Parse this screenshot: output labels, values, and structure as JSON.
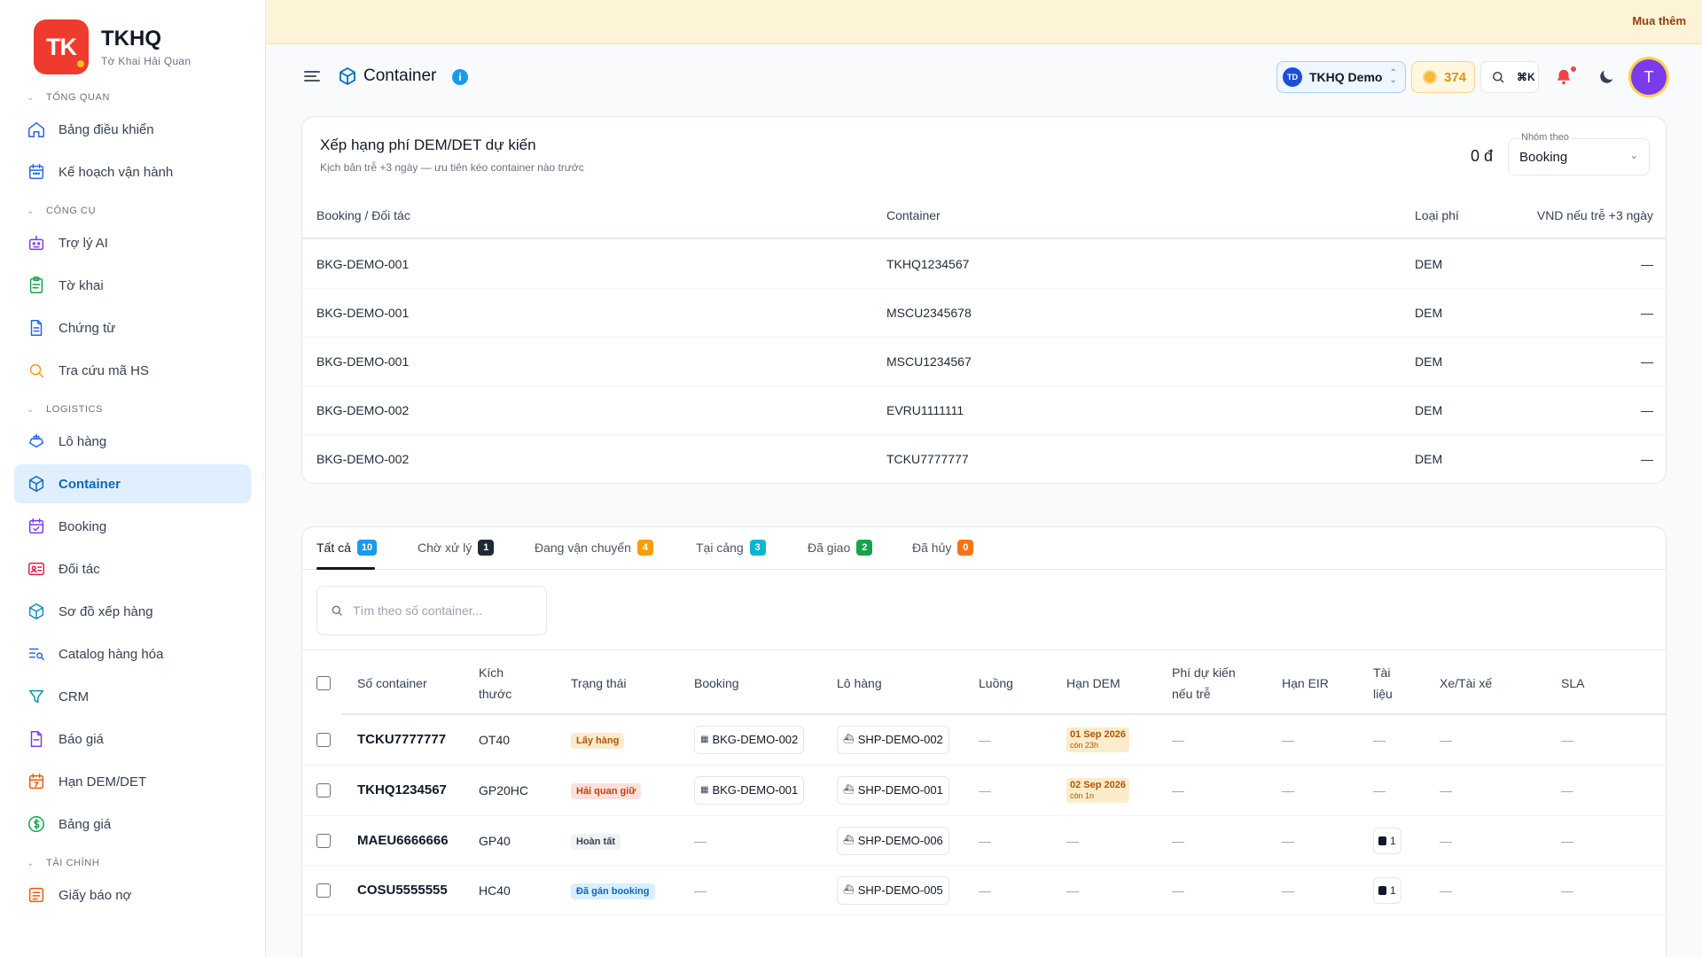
{
  "brand": {
    "logo": "TK",
    "title": "TKHQ",
    "subtitle": "Tờ Khai Hải Quan"
  },
  "sidebar": {
    "sections": [
      {
        "title": "TỔNG QUAN",
        "items": [
          {
            "label": "Bảng điều khiển",
            "icon": "home-icon"
          },
          {
            "label": "Kế hoạch vận hành",
            "icon": "calendar-icon"
          }
        ]
      },
      {
        "title": "CÔNG CỤ",
        "items": [
          {
            "label": "Trợ lý AI",
            "icon": "robot-icon"
          },
          {
            "label": "Tờ khai",
            "icon": "clipboard-icon"
          },
          {
            "label": "Chứng từ",
            "icon": "document-icon"
          },
          {
            "label": "Tra cứu mã HS",
            "icon": "search-icon"
          }
        ]
      },
      {
        "title": "LOGISTICS",
        "items": [
          {
            "label": "Lô hàng",
            "icon": "ship-icon"
          },
          {
            "label": "Container",
            "icon": "box-icon",
            "active": true
          },
          {
            "label": "Booking",
            "icon": "calendar-check-icon"
          },
          {
            "label": "Đối tác",
            "icon": "id-card-icon"
          },
          {
            "label": "Sơ đồ xếp hàng",
            "icon": "cube-icon"
          },
          {
            "label": "Catalog hàng hóa",
            "icon": "list-search-icon"
          },
          {
            "label": "CRM",
            "icon": "funnel-icon"
          },
          {
            "label": "Báo giá",
            "icon": "quote-icon"
          },
          {
            "label": "Hạn DEM/DET",
            "icon": "calendar-deadline-icon"
          },
          {
            "label": "Bảng giá",
            "icon": "dollar-icon"
          }
        ]
      },
      {
        "title": "TÀI CHÍNH",
        "items": [
          {
            "label": "Giấy báo nợ",
            "icon": "receipt-icon"
          }
        ]
      }
    ]
  },
  "banner": {
    "buy_label": "Mua thêm"
  },
  "header": {
    "title": "Container",
    "workspace_initials": "TD",
    "workspace_name": "TKHQ Demo",
    "coins": "374",
    "search_shortcut": "⌘K",
    "user_initial": "T"
  },
  "ranking": {
    "title": "Xếp hạng phí DEM/DET dự kiến",
    "subtitle": "Kịch bản trễ +3 ngày — ưu tiên kéo container nào trước",
    "total": "0 đ",
    "group_label": "Nhóm theo",
    "group_value": "Booking",
    "columns": [
      "Booking / Đối tác",
      "Container",
      "Loại phí",
      "VND nếu trễ +3 ngày"
    ],
    "rows": [
      {
        "booking": "BKG-DEMO-001",
        "container": "TKHQ1234567",
        "fee": "DEM",
        "vnd": "—"
      },
      {
        "booking": "BKG-DEMO-001",
        "container": "MSCU2345678",
        "fee": "DEM",
        "vnd": "—"
      },
      {
        "booking": "BKG-DEMO-001",
        "container": "MSCU1234567",
        "fee": "DEM",
        "vnd": "—"
      },
      {
        "booking": "BKG-DEMO-002",
        "container": "EVRU1111111",
        "fee": "DEM",
        "vnd": "—"
      },
      {
        "booking": "BKG-DEMO-002",
        "container": "TCKU7777777",
        "fee": "DEM",
        "vnd": "—"
      }
    ]
  },
  "tabs": [
    {
      "label": "Tất cả",
      "count": "10",
      "color": "#1a9bea"
    },
    {
      "label": "Chờ xử lý",
      "count": "1",
      "color": "#1f2937"
    },
    {
      "label": "Đang vận chuyển",
      "count": "4",
      "color": "#f59e0b"
    },
    {
      "label": "Tại cảng",
      "count": "3",
      "color": "#06b6d4"
    },
    {
      "label": "Đã giao",
      "count": "2",
      "color": "#16a34a"
    },
    {
      "label": "Đã hủy",
      "count": "0",
      "color": "#f97316"
    }
  ],
  "search": {
    "placeholder": "Tìm theo số container...",
    "value": ""
  },
  "list": {
    "columns": {
      "container": "Số container",
      "size": "Kích thước",
      "status": "Trạng thái",
      "booking": "Booking",
      "shipment": "Lô hàng",
      "route": "Luồng",
      "dem": "Hạn DEM",
      "fee": "Phí dự kiến nếu trễ",
      "eir": "Hạn EIR",
      "docs": "Tài liệu",
      "truck": "Xe/Tài xế",
      "sla": "SLA"
    },
    "rows": [
      {
        "container": "TCKU7777777",
        "size": "OT40",
        "status": "Lấy hàng",
        "status_color": "orange",
        "booking": "BKG-DEMO-002",
        "shipment": "SHP-DEMO-002",
        "route": "—",
        "dem_date": "01 Sep 2026",
        "dem_left": "còn 23h",
        "fee": "—",
        "eir": "—",
        "docs": "—",
        "truck": "—",
        "sla": "—"
      },
      {
        "container": "TKHQ1234567",
        "size": "GP20HC",
        "status": "Hải quan giữ",
        "status_color": "red",
        "booking": "BKG-DEMO-001",
        "shipment": "SHP-DEMO-001",
        "route": "—",
        "dem_date": "02 Sep 2026",
        "dem_left": "còn 1n",
        "fee": "—",
        "eir": "—",
        "docs": "—",
        "truck": "—",
        "sla": "—"
      },
      {
        "container": "MAEU6666666",
        "size": "GP40",
        "status": "Hoàn tất",
        "status_color": "gray",
        "booking": "—",
        "shipment": "SHP-DEMO-006",
        "route": "—",
        "dem": "—",
        "fee": "—",
        "eir": "—",
        "docs_count": "1",
        "truck": "—",
        "sla": "—"
      },
      {
        "container": "COSU5555555",
        "size": "HC40",
        "status": "Đã gán booking",
        "status_color": "blue",
        "booking": "—",
        "shipment": "SHP-DEMO-005",
        "route": "—",
        "dem": "—",
        "fee": "—",
        "eir": "—",
        "docs_count": "1",
        "truck": "—",
        "sla": "—"
      }
    ]
  }
}
